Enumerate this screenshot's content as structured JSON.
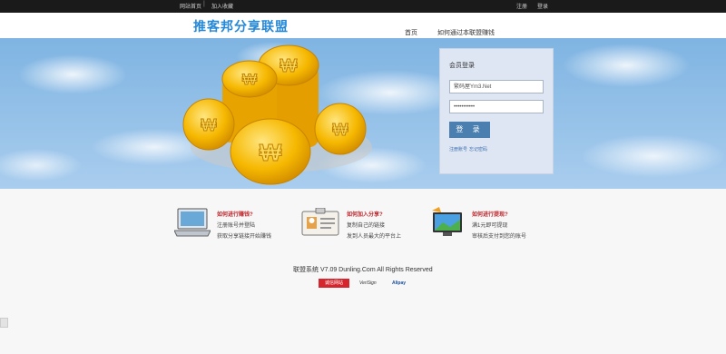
{
  "topbar": {
    "home_link": "网站首页",
    "favorite_link": "加入收藏",
    "register": "注册",
    "login": "登录"
  },
  "header": {
    "logo": "推客邦分享联盟",
    "nav": [
      "首页",
      "如何通过本联盟赚钱"
    ]
  },
  "login": {
    "title": "会员登录",
    "username_value": "繁码屋Ym3.Net",
    "password_value": "•••••••••••",
    "submit": "登 录",
    "register_link": "注册账号",
    "forgot_link": "忘记密码"
  },
  "features": [
    {
      "title": "如何进行赚钱?",
      "line1": "注册账号并登陆",
      "line2": "获取分享链接开始赚钱",
      "icon": "laptop-icon"
    },
    {
      "title": "如何加入分享?",
      "line1": "复制自己的链接",
      "line2": "发到人员最大的平台上",
      "icon": "id-card-icon"
    },
    {
      "title": "如何进行提现?",
      "line1": "满1元即可提现",
      "line2": "审核后支付到您的账号",
      "icon": "monitor-icon"
    }
  ],
  "footer": {
    "copyright": "联盟系统 V7.09 Dunling.Com All Rights Reserved",
    "badges": [
      "诚信网站",
      "VeriSign",
      "Alipay"
    ]
  },
  "colors": {
    "accent": "#4a7fb0",
    "logo": "#2488d8",
    "feature_title": "#c0272d"
  }
}
